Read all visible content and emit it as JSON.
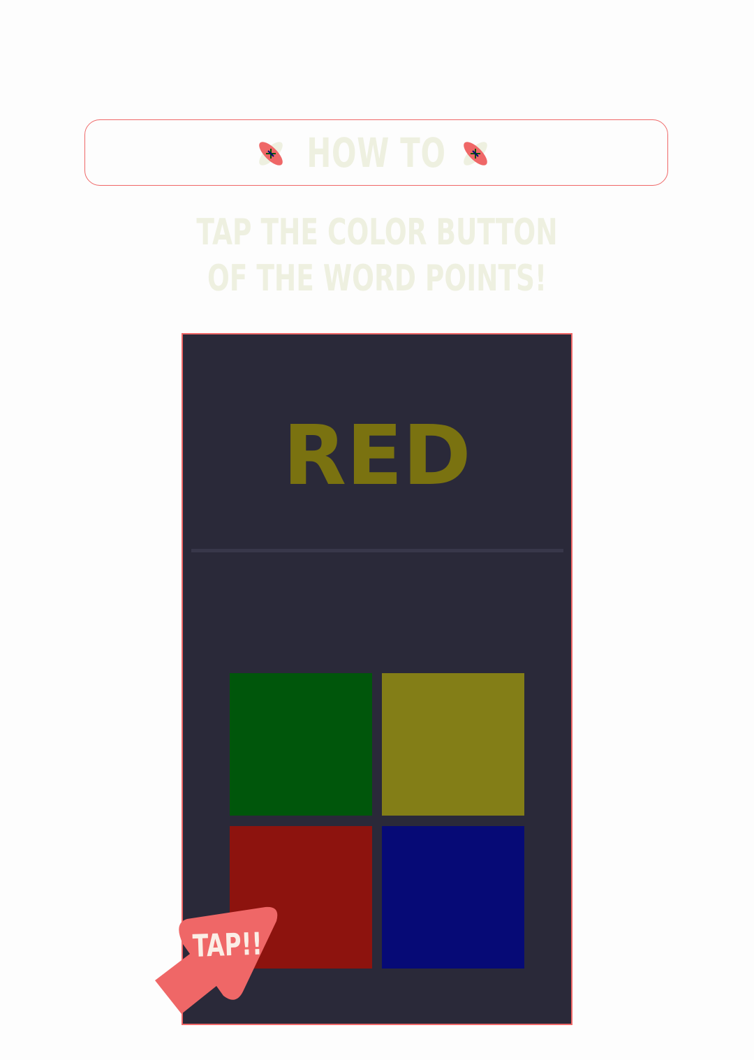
{
  "header": {
    "title": "HOW TO",
    "icon": "flower-icon"
  },
  "instructions": {
    "line1": "TAP THE COLOR BUTTON",
    "line2": "OF THE WORD POINTS!"
  },
  "demo": {
    "word": "RED",
    "word_color": "#7a7210",
    "buttons": [
      {
        "name": "green",
        "color": "#00560b"
      },
      {
        "name": "yellow",
        "color": "#837e17"
      },
      {
        "name": "red",
        "color": "#8d130e"
      },
      {
        "name": "blue",
        "color": "#060a76"
      }
    ],
    "pointer": {
      "label": "TAP!!",
      "icon": "pointer-arrow-icon",
      "color": "#ef6767"
    }
  },
  "colors": {
    "accent": "#ef6767",
    "text_light": "#eef0e0",
    "screen_bg": "#2a2939"
  }
}
